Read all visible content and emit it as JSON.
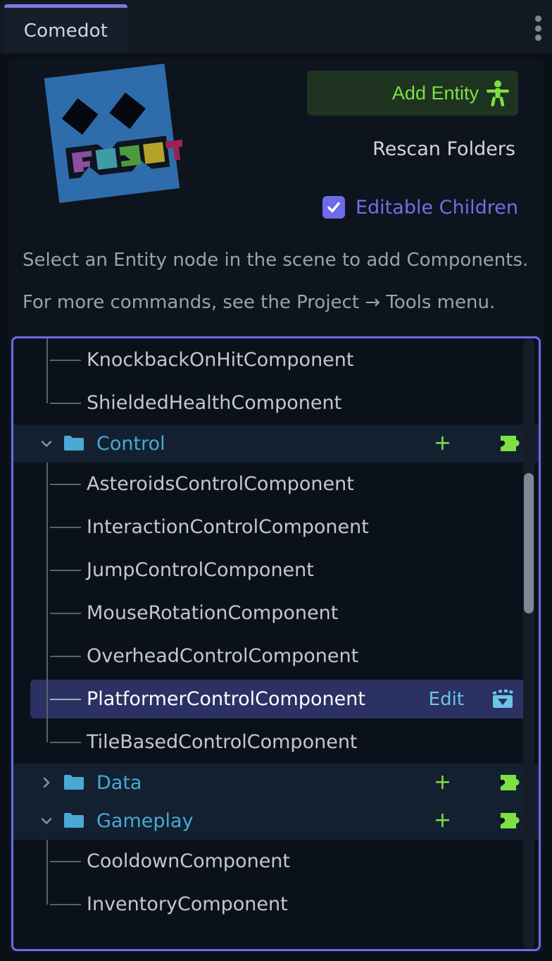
{
  "window": {
    "tab_label": "Comedot",
    "menu_icon": "kebab-menu-icon"
  },
  "header": {
    "logo_alt": "comedot-logo",
    "add_entity_label": "Add Entity",
    "add_entity_icon": "character-body-icon",
    "rescan_label": "Rescan Folders",
    "editable_children_label": "Editable Children",
    "editable_children_checked": true
  },
  "info": {
    "line1": "Select an Entity node in the scene to add Components.",
    "line2": "For more commands, see the Project → Tools menu."
  },
  "tree": {
    "edit_label": "Edit",
    "add_icon": "plus-icon",
    "component_icon": "puzzle-piece-icon",
    "folder_icon": "folder-icon",
    "edit_icon": "load-scene-icon",
    "rows": [
      {
        "type": "leaf",
        "label": "KnockbackOnHitComponent",
        "selected": false
      },
      {
        "type": "leaf",
        "label": "ShieldedHealthComponent",
        "selected": false
      },
      {
        "type": "folder",
        "label": "Control",
        "expanded": true
      },
      {
        "type": "leaf",
        "label": "AsteroidsControlComponent",
        "selected": false
      },
      {
        "type": "leaf",
        "label": "InteractionControlComponent",
        "selected": false
      },
      {
        "type": "leaf",
        "label": "JumpControlComponent",
        "selected": false
      },
      {
        "type": "leaf",
        "label": "MouseRotationComponent",
        "selected": false
      },
      {
        "type": "leaf",
        "label": "OverheadControlComponent",
        "selected": false
      },
      {
        "type": "leaf",
        "label": "PlatformerControlComponent",
        "selected": true
      },
      {
        "type": "leaf",
        "label": "TileBasedControlComponent",
        "selected": false
      },
      {
        "type": "folder",
        "label": "Data",
        "expanded": false
      },
      {
        "type": "folder",
        "label": "Gameplay",
        "expanded": true
      },
      {
        "type": "leaf",
        "label": "CooldownComponent",
        "selected": false
      },
      {
        "type": "leaf",
        "label": "InventoryComponent",
        "selected": false
      }
    ],
    "scrollbar": {
      "thumb_top_pct": 22,
      "thumb_height_pct": 23
    }
  },
  "colors": {
    "accent_focus": "#6c6ce8",
    "accent_green": "#7ee043",
    "folder_blue": "#49a8d4",
    "selected_row": "#2b3163",
    "panel_bg": "#0d141e",
    "list_bg": "#0b111a",
    "folder_row_bg": "#132030",
    "logo_blue": "#2f6cab"
  }
}
